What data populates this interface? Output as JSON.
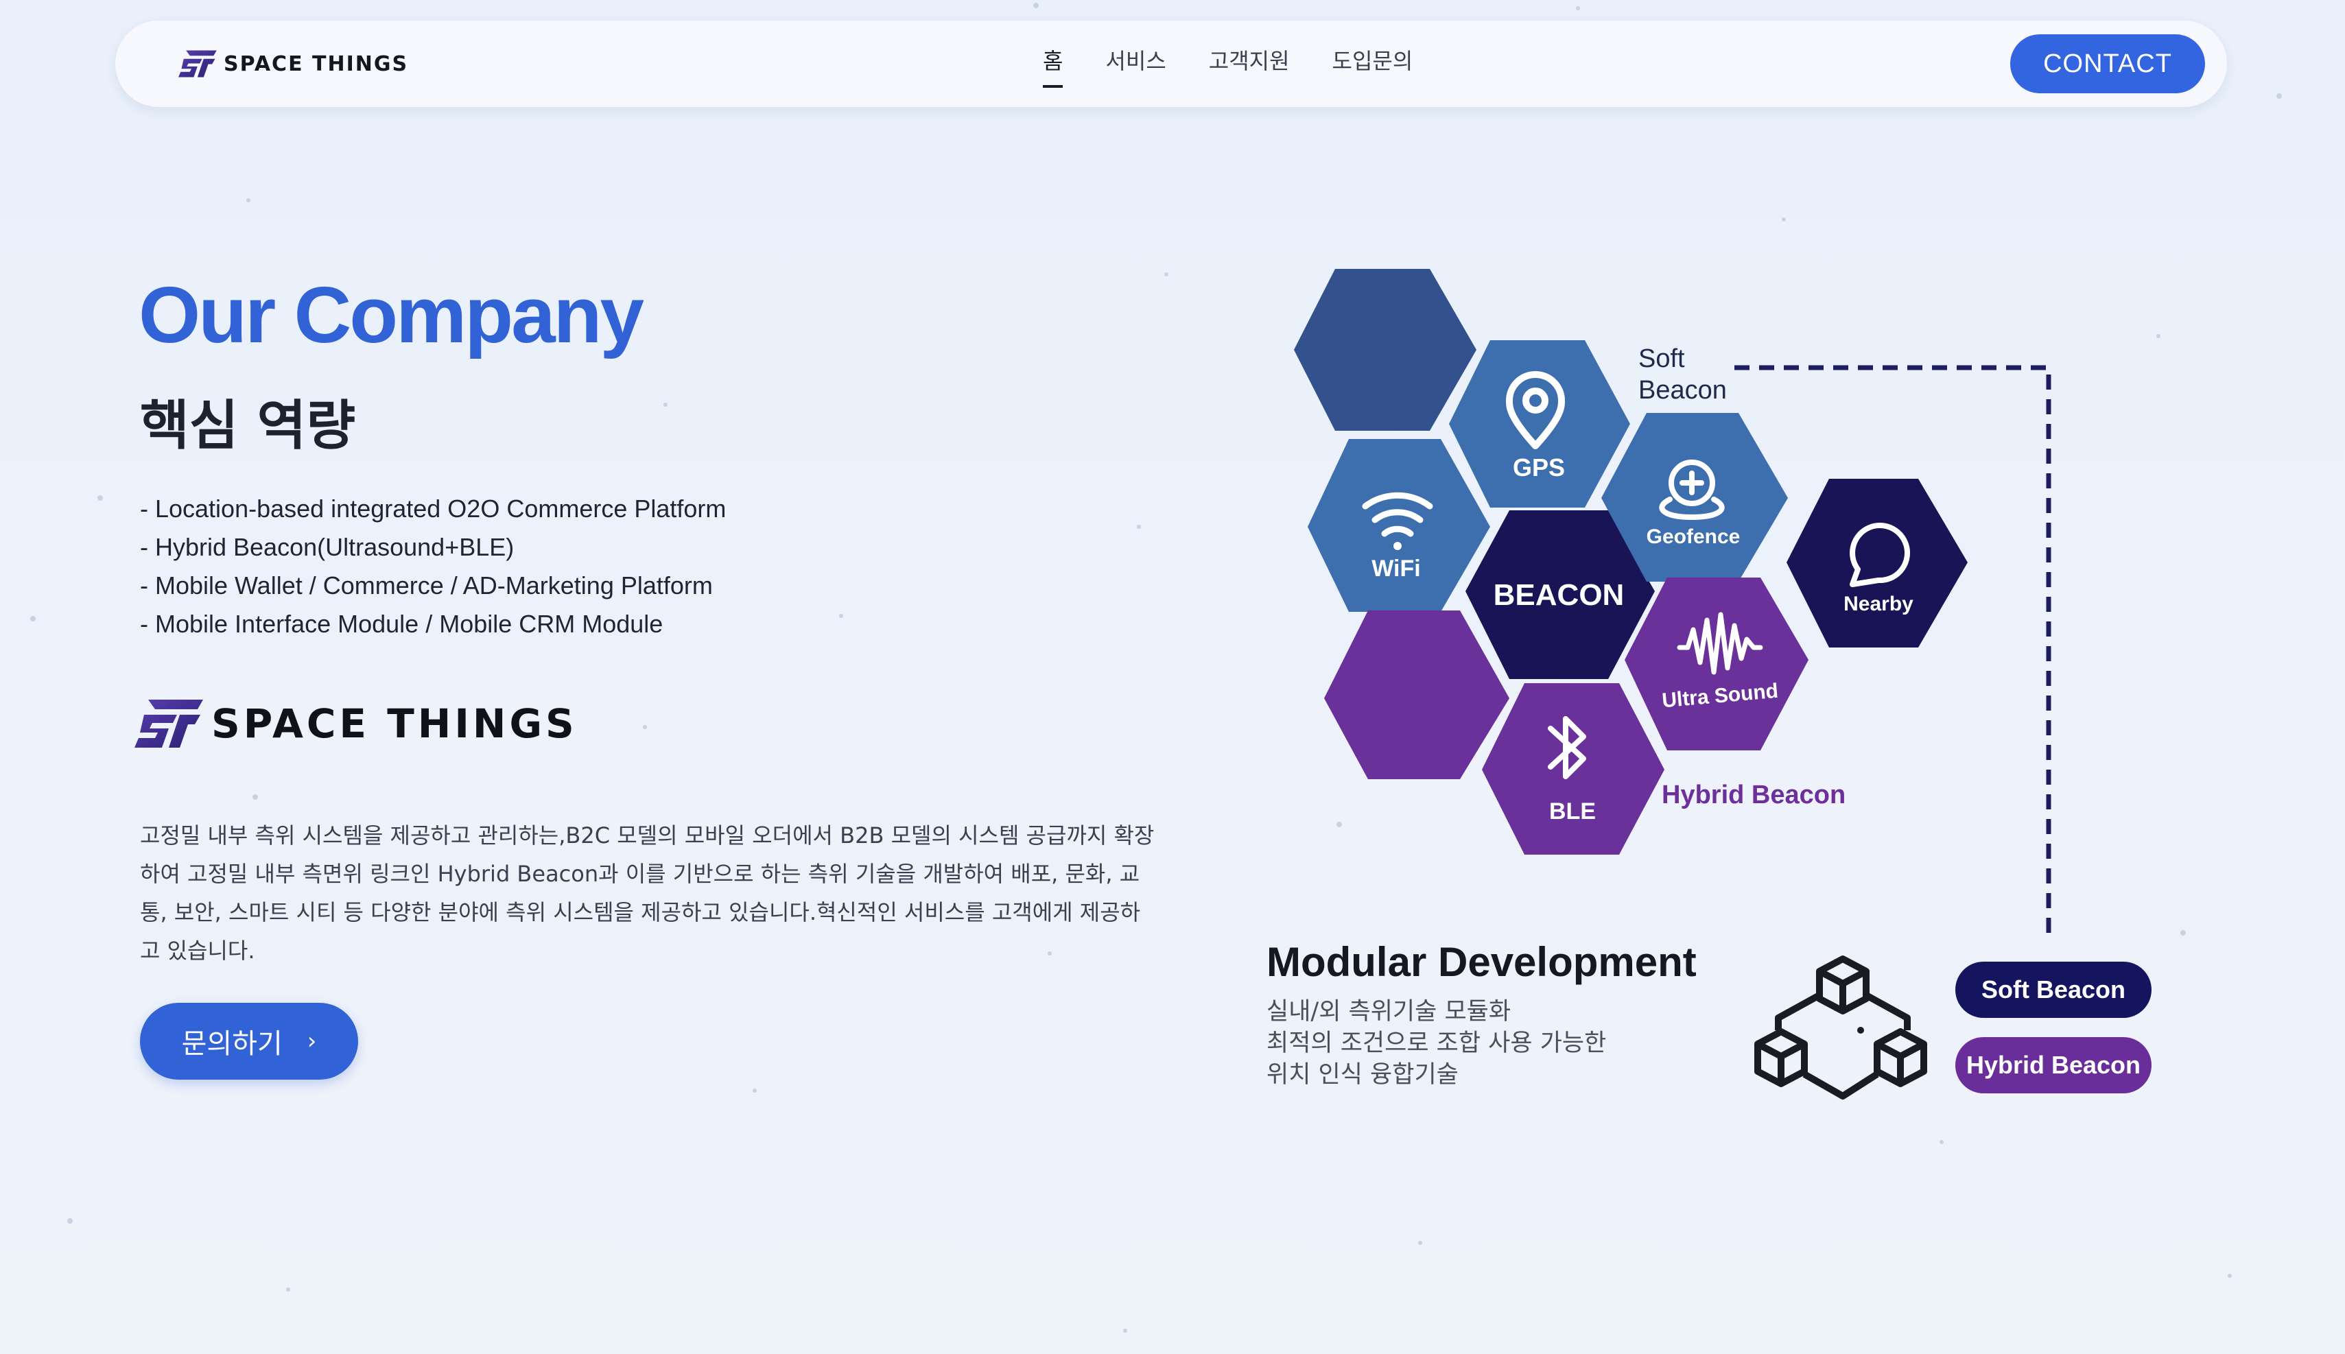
{
  "nav": {
    "brand": "SPACE THINGS",
    "links": [
      {
        "label": "홈",
        "active": true
      },
      {
        "label": "서비스",
        "active": false
      },
      {
        "label": "고객지원",
        "active": false
      },
      {
        "label": "도입문의",
        "active": false
      }
    ],
    "contact_label": "CONTACT"
  },
  "hero": {
    "title": "Our Company",
    "subtitle": "핵심 역량",
    "bullets": [
      "- Location-based integrated O2O Commerce Platform",
      "- Hybrid Beacon(Ultrasound+BLE)",
      "- Mobile Wallet / Commerce / AD-Marketing Platform",
      "- Mobile Interface Module / Mobile CRM Module"
    ],
    "brand": "SPACE THINGS",
    "description": "고정밀 내부 측위 시스템을 제공하고 관리하는,B2C 모델의 모바일 오더에서 B2B 모델의 시스템 공급까지 확장하여 고정밀 내부 측면위 링크인 Hybrid Beacon과 이를 기반으로 하는 측위 기술을 개발하여 배포, 문화, 교통, 보안, 스마트 시티 등 다양한 분야에 측위 시스템을 제공하고 있습니다.혁신적인 서비스를 고객에게 제공하고 있습니다.",
    "inquiry_label": "문의하기",
    "inquiry_chevron": "›"
  },
  "diagram": {
    "hexes": {
      "gps": "GPS",
      "wifi": "WiFi",
      "beacon": "BEACON",
      "geofence": "Geofence",
      "ultra_sound": "Ultra Sound",
      "ble": "BLE",
      "nearby": "Nearby"
    },
    "soft_beacon_note": [
      "Soft",
      "Beacon"
    ],
    "hybrid_beacon_label": "Hybrid Beacon",
    "colors": {
      "dark_blue": "#33528d",
      "mid_blue": "#3d6fae",
      "navy": "#191455",
      "purple": "#6a319a",
      "dashed_line": "#1d1c5e"
    }
  },
  "modular": {
    "title": "Modular Development",
    "lines": [
      "실내/외 측위기술 모듈화",
      "최적의 조건으로 조합 사용 가능한",
      "위치 인식 융합기술"
    ],
    "pills": {
      "soft": "Soft Beacon",
      "hybrid": "Hybrid Beacon"
    },
    "icon": "blocks-cube-icon"
  }
}
